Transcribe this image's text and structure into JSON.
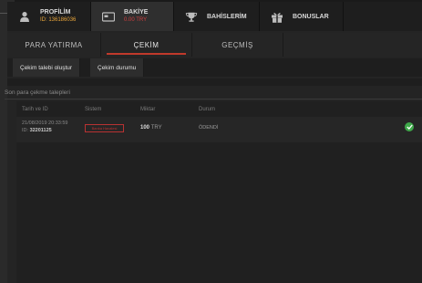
{
  "nav": {
    "profile": {
      "title": "PROFİLİM",
      "subtitle": "ID: 136186036"
    },
    "balance": {
      "title": "BAKİYE",
      "subtitle": "0.00 TRY"
    },
    "bets": {
      "title": "BAHİSLERİM"
    },
    "bonuses": {
      "title": "BONUSLAR"
    }
  },
  "sections": {
    "deposit": "PARA YATIRMA",
    "withdraw": "ÇEKİM",
    "history": "GEÇMİŞ"
  },
  "subtabs": {
    "create": "Çekim talebi oluştur",
    "status": "Çekim durumu"
  },
  "list": {
    "title": "Son para çekme talepleri",
    "columns": {
      "date": "Tarih ve ID",
      "system": "Sistem",
      "amount": "Miktar",
      "status": "Durum"
    },
    "rows": [
      {
        "date": "21/08/2019 20:33:59",
        "id_label": "ID:",
        "id": "32201125",
        "system": "Banka Havalesi",
        "amount": "100",
        "currency": "TRY",
        "status": "ÖDENDİ"
      }
    ]
  },
  "colors": {
    "accent": "#c0392b",
    "brand": "#e8a53a",
    "success": "#3fa84a"
  },
  "icons": {
    "profile": "user-icon",
    "balance": "wallet-icon",
    "bets": "trophy-icon",
    "bonuses": "gift-icon",
    "status": "check-circle-icon"
  }
}
